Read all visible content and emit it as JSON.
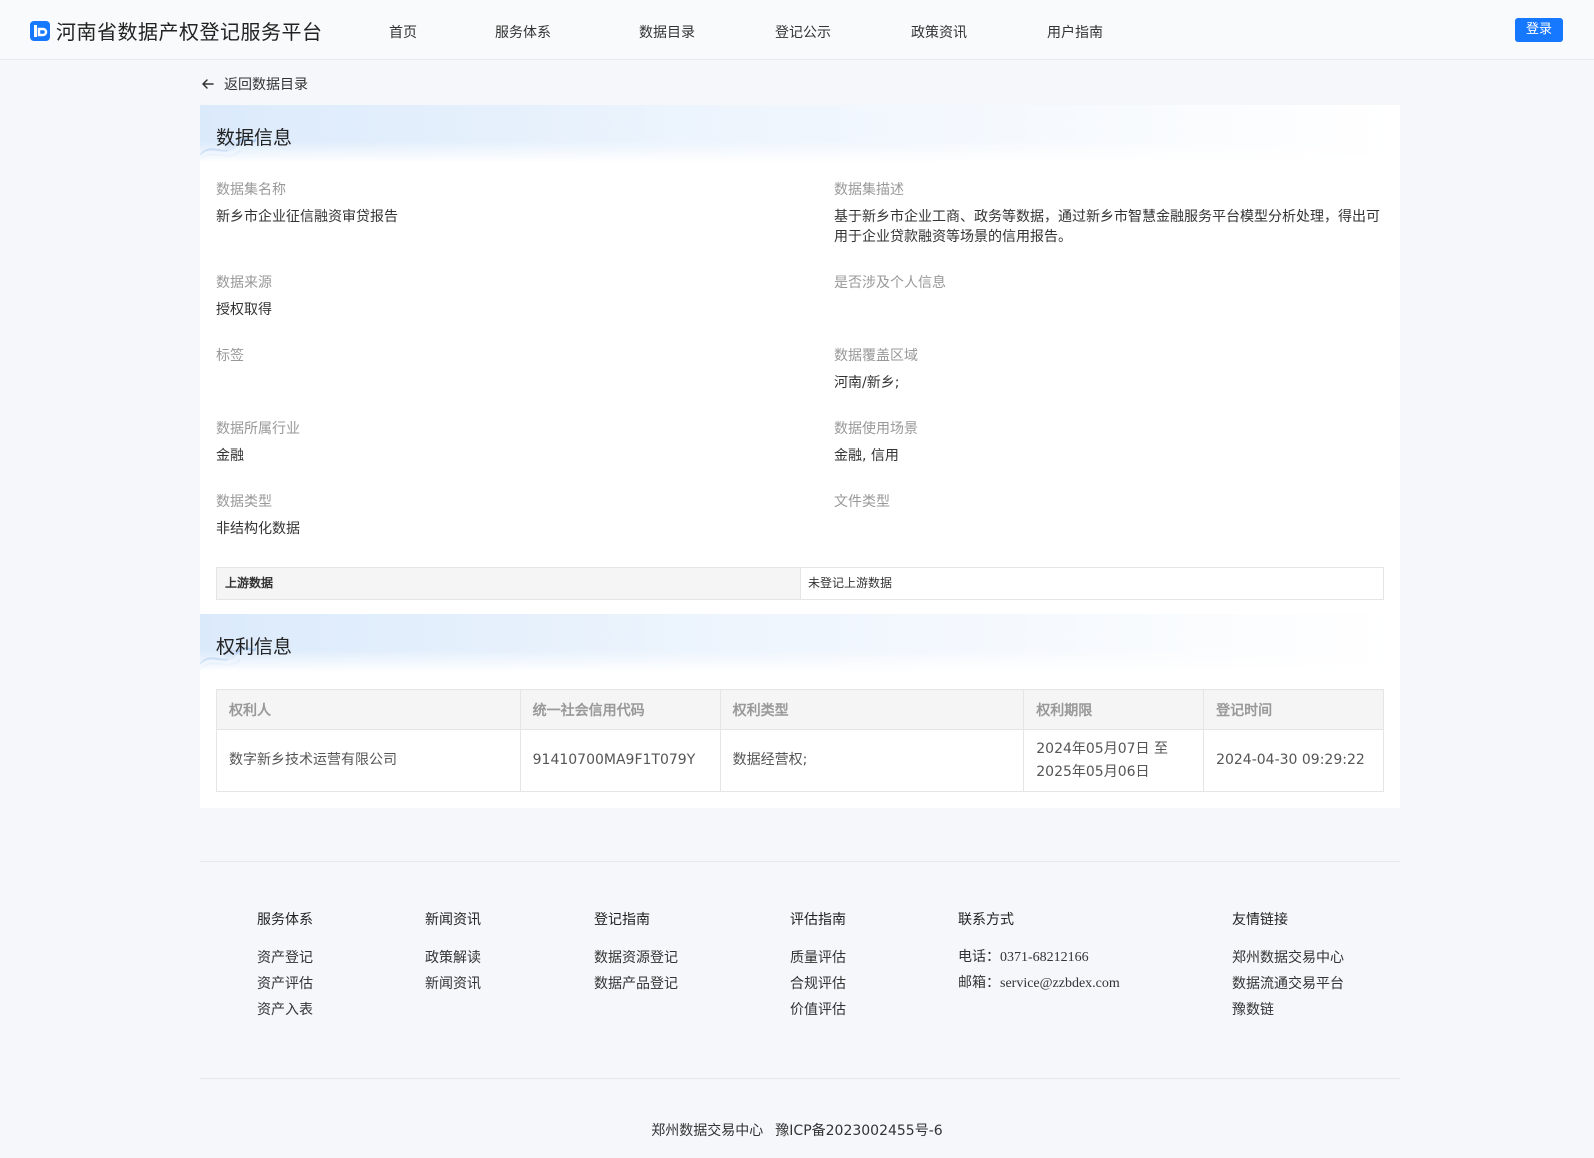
{
  "header": {
    "site_title": "河南省数据产权登记服务平台",
    "nav": [
      "首页",
      "服务体系",
      "数据目录",
      "登记公示",
      "政策资讯",
      "用户指南"
    ],
    "login_label": "登录"
  },
  "back_label": "返回数据目录",
  "data_info": {
    "title": "数据信息",
    "fields": [
      {
        "label": "数据集名称",
        "value": "新乡市企业征信融资审贷报告"
      },
      {
        "label": "数据集描述",
        "value": "基于新乡市企业工商、政务等数据，通过新乡市智慧金融服务平台模型分析处理，得出可用于企业贷款融资等场景的信用报告。"
      },
      {
        "label": "数据来源",
        "value": "授权取得"
      },
      {
        "label": "是否涉及个人信息",
        "value": ""
      },
      {
        "label": "标签",
        "value": ""
      },
      {
        "label": "数据覆盖区域",
        "value": "河南/新乡;"
      },
      {
        "label": "数据所属行业",
        "value": "金融"
      },
      {
        "label": "数据使用场景",
        "value": "金融, 信用"
      },
      {
        "label": "数据类型",
        "value": "非结构化数据"
      },
      {
        "label": "文件类型",
        "value": ""
      }
    ],
    "upstream": {
      "label": "上游数据",
      "value": "未登记上游数据"
    }
  },
  "rights_info": {
    "title": "权利信息",
    "columns": [
      "权利人",
      "统一社会信用代码",
      "权利类型",
      "权利期限",
      "登记时间"
    ],
    "rows": [
      {
        "holder": "数字新乡技术运营有限公司",
        "code": "91410700MA9F1T079Y",
        "type": "数据经营权;",
        "period_start": "2024年05月07日 至",
        "period_end": "2025年05月06日",
        "registered": "2024-04-30 09:29:22"
      }
    ]
  },
  "footer": {
    "columns": [
      {
        "title": "服务体系",
        "items": [
          "资产登记",
          "资产评估",
          "资产入表"
        ]
      },
      {
        "title": "新闻资讯",
        "items": [
          "政策解读",
          "新闻资讯"
        ]
      },
      {
        "title": "登记指南",
        "items": [
          "数据资源登记",
          "数据产品登记"
        ]
      },
      {
        "title": "评估指南",
        "items": [
          "质量评估",
          "合规评估",
          "价值评估"
        ]
      },
      {
        "title": "联系方式",
        "items": [
          "电话：0371-68212166",
          "邮箱：service@zzbdex.com"
        ]
      },
      {
        "title": "友情链接",
        "items": [
          "郑州数据交易中心",
          "数据流通交易平台",
          "豫数链"
        ]
      }
    ],
    "org": "郑州数据交易中心",
    "icp": "豫ICP备2023002455号-6"
  },
  "colors": {
    "accent": "#1677ff",
    "background": "#f5f7fa"
  }
}
